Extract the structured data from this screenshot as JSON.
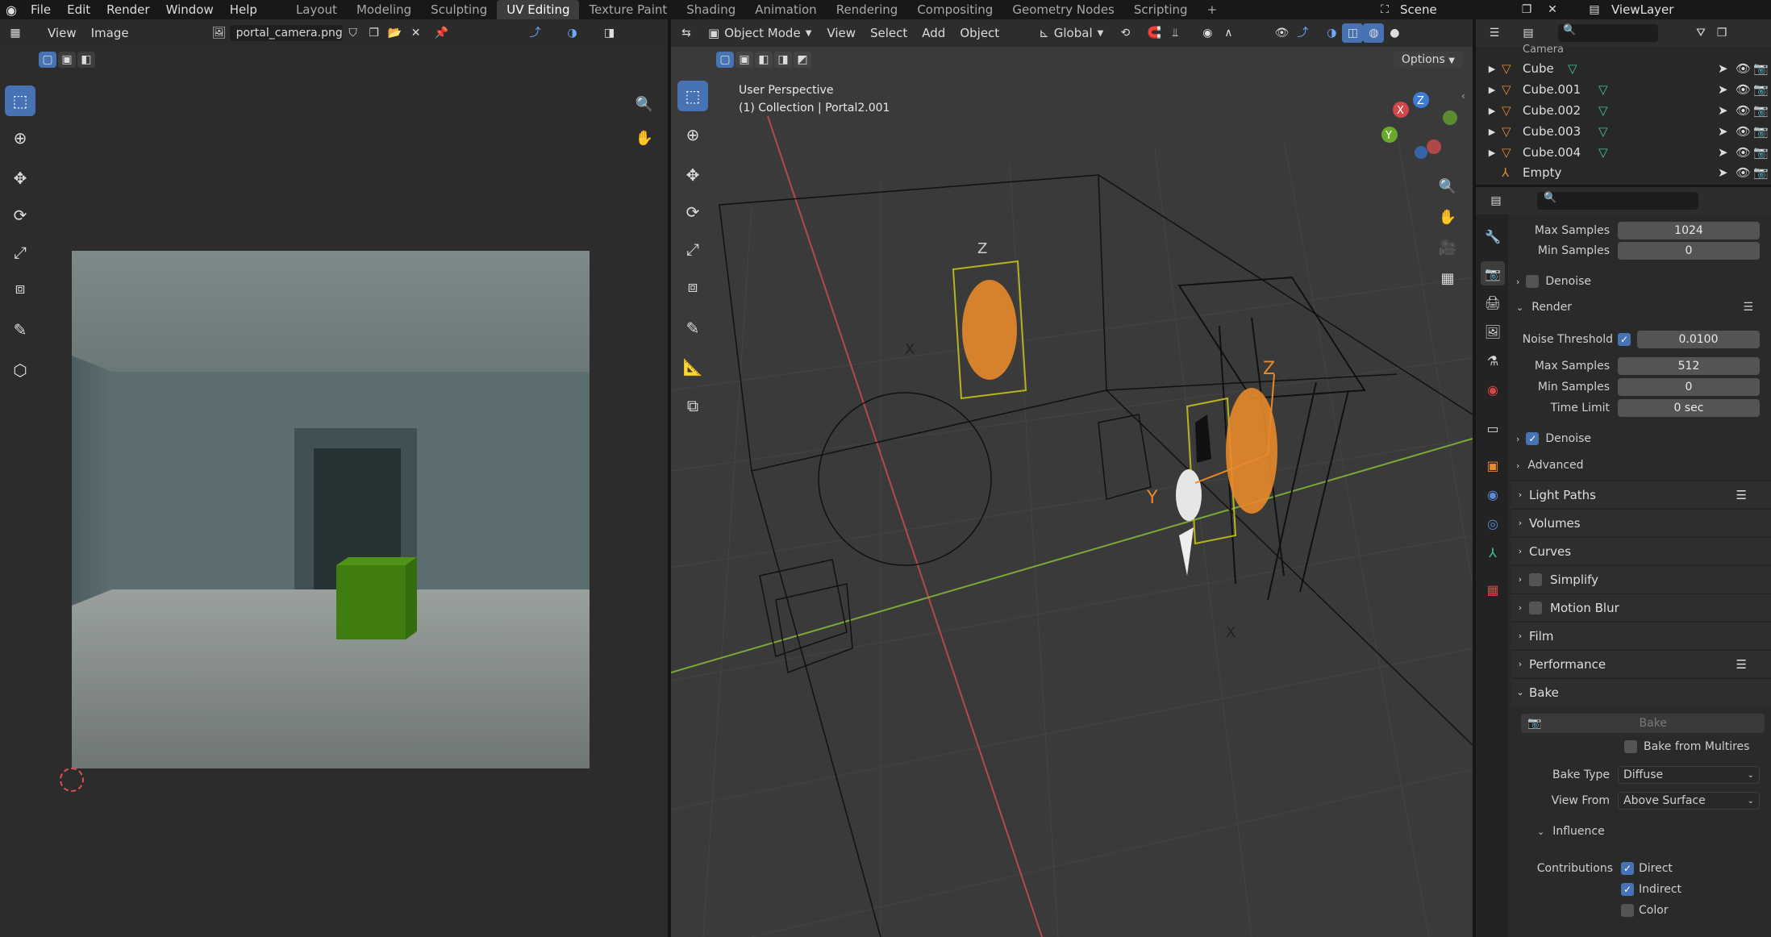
{
  "topbar": {
    "menus": [
      "File",
      "Edit",
      "Render",
      "Window",
      "Help"
    ],
    "workspaces": [
      "Layout",
      "Modeling",
      "Sculpting",
      "UV Editing",
      "Texture Paint",
      "Shading",
      "Animation",
      "Rendering",
      "Compositing",
      "Geometry Nodes",
      "Scripting"
    ],
    "add_tab": "+",
    "scene": "Scene",
    "view_layer": "ViewLayer"
  },
  "image_editor": {
    "menu_view": "View",
    "menu_image": "Image",
    "image_name": "portal_camera.png"
  },
  "viewport": {
    "mode": "Object Mode",
    "menu_view": "View",
    "menu_select": "Select",
    "menu_add": "Add",
    "menu_object": "Object",
    "transform": "Global",
    "options": "Options",
    "info_line1": "User Perspective",
    "info_line2": "(1) Collection | Portal2.001",
    "gizmo_x": "X",
    "gizmo_y": "Y",
    "gizmo_z": "Z",
    "axis_z1": "Z",
    "axis_x1": "X",
    "axis_z2": "Z",
    "axis_y2": "Y",
    "axis_x2": "X"
  },
  "outliner": {
    "items": [
      "Camera",
      "Cube",
      "Cube.001",
      "Cube.002",
      "Cube.003",
      "Cube.004",
      "Empty"
    ]
  },
  "properties": {
    "max_samples_label": "Max Samples",
    "max_samples_value": "1024",
    "min_samples_label": "Min Samples",
    "min_samples_value": "0",
    "denoise1": "Denoise",
    "render_header": "Render",
    "noise_threshold_label": "Noise Threshold",
    "noise_threshold_value": "0.0100",
    "r_max_samples_label": "Max Samples",
    "r_max_samples_value": "512",
    "r_min_samples_label": "Min Samples",
    "r_min_samples_value": "0",
    "time_limit_label": "Time Limit",
    "time_limit_value": "0 sec",
    "denoise2": "Denoise",
    "advanced": "Advanced",
    "sections": [
      "Light Paths",
      "Volumes",
      "Curves",
      "Simplify",
      "Motion Blur",
      "Film",
      "Performance",
      "Bake"
    ],
    "bake_button": "Bake",
    "bake_from_multires": "Bake from Multires",
    "bake_type_label": "Bake Type",
    "bake_type_value": "Diffuse",
    "view_from_label": "View From",
    "view_from_value": "Above Surface",
    "influence": "Influence",
    "contributions_label": "Contributions",
    "direct": "Direct",
    "indirect": "Indirect",
    "color": "Color"
  },
  "colors": {
    "accent": "#4772b3",
    "selected_orange": "#e8892a",
    "ground_green": "#3c7d1e"
  }
}
